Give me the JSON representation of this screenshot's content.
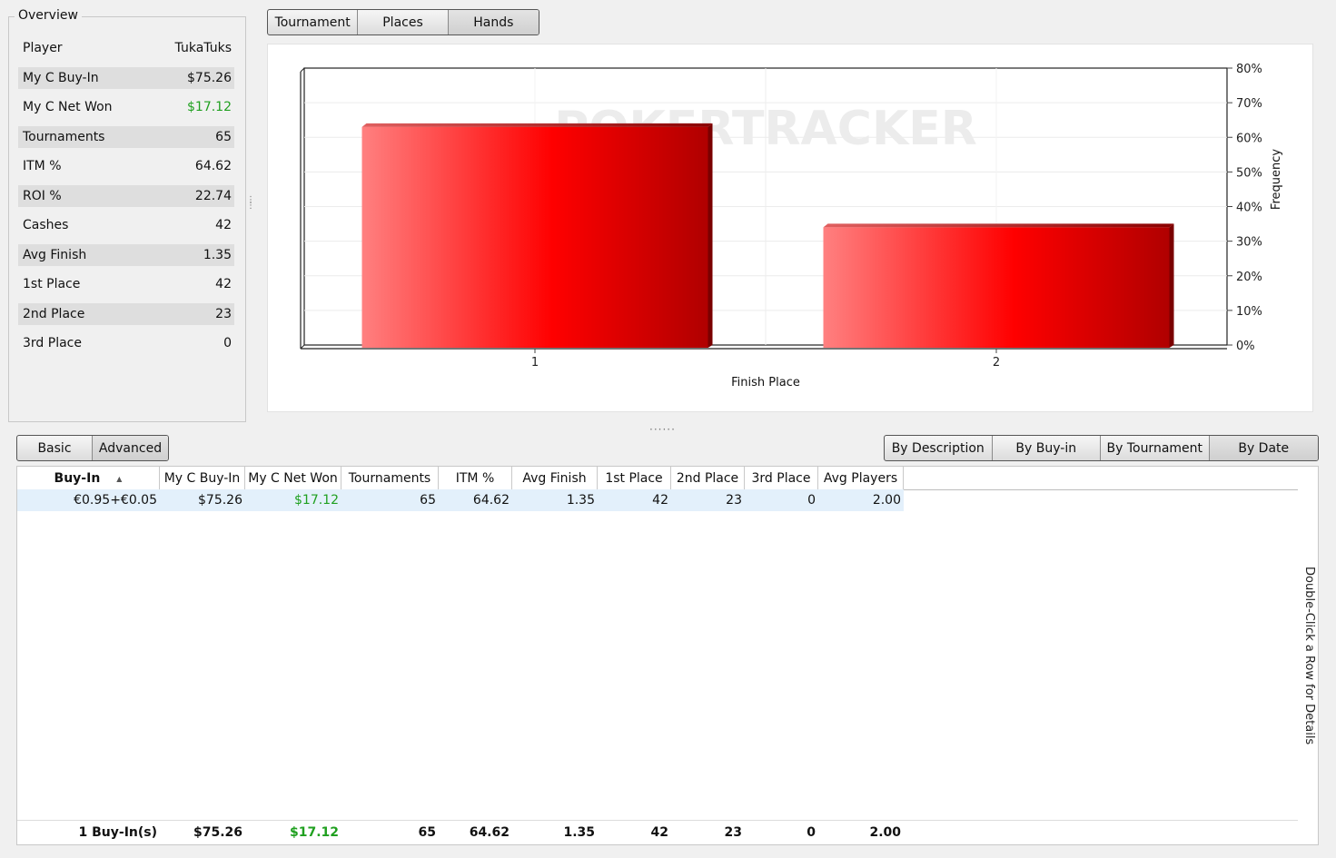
{
  "overview": {
    "title": "Overview",
    "rows": [
      {
        "label": "Player",
        "value": "TukaTuks"
      },
      {
        "label": "My C Buy-In",
        "value": "$75.26"
      },
      {
        "label": "My C Net Won",
        "value": "$17.12"
      },
      {
        "label": "Tournaments",
        "value": "65"
      },
      {
        "label": "ITM %",
        "value": "64.62"
      },
      {
        "label": "ROI %",
        "value": "22.74"
      },
      {
        "label": "Cashes",
        "value": "42"
      },
      {
        "label": "Avg Finish",
        "value": "1.35"
      },
      {
        "label": "1st Place",
        "value": "42"
      },
      {
        "label": "2nd Place",
        "value": "23"
      },
      {
        "label": "3rd Place",
        "value": "0"
      }
    ]
  },
  "top_tabs": [
    "Tournament",
    "Places",
    "Hands"
  ],
  "chart_data": {
    "type": "bar",
    "categories": [
      "1",
      "2"
    ],
    "values": [
      63,
      34
    ],
    "xlabel": "Finish Place",
    "ylabel": "Frequency",
    "ylim": [
      0,
      80
    ],
    "yticks": [
      "0%",
      "10%",
      "20%",
      "30%",
      "40%",
      "50%",
      "60%",
      "70%",
      "80%"
    ],
    "watermark": "POKERTRACKER",
    "bar_color": "#ff0000"
  },
  "view_tabs": [
    "Basic",
    "Advanced"
  ],
  "group_tabs": [
    "By Description",
    "By Buy-in",
    "By Tournament",
    "By Date"
  ],
  "table": {
    "headers": [
      "Buy-In",
      "My C Buy-In",
      "My C Net Won",
      "Tournaments",
      "ITM %",
      "Avg Finish",
      "1st Place",
      "2nd Place",
      "3rd Place",
      "Avg Players"
    ],
    "rows": [
      [
        "€0.95+€0.05",
        "$75.26",
        "$17.12",
        "65",
        "64.62",
        "1.35",
        "42",
        "23",
        "0",
        "2.00"
      ]
    ],
    "totals": [
      "1 Buy-In(s)",
      "$75.26",
      "$17.12",
      "65",
      "64.62",
      "1.35",
      "42",
      "23",
      "0",
      "2.00"
    ],
    "side_hint": "Double-Click a Row for Details"
  },
  "colors": {
    "positive": "#20a020",
    "bar": "#ff0000"
  }
}
